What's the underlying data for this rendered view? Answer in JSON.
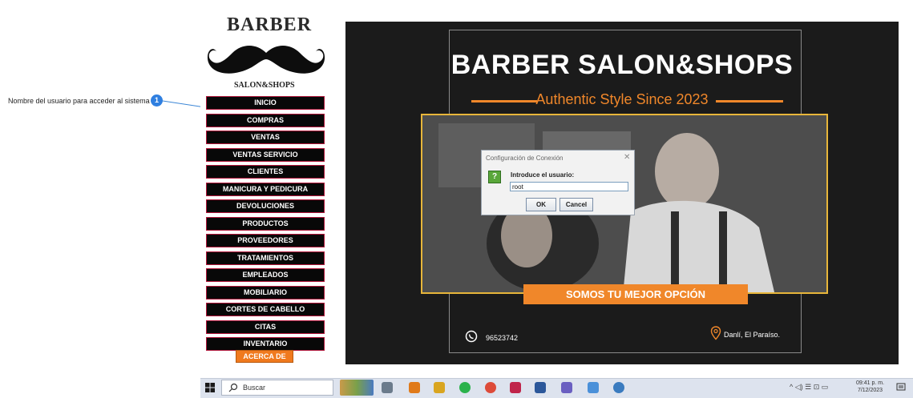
{
  "annotation": {
    "text": "Nombre del usuario para acceder al sistema",
    "badge": "1"
  },
  "app": {
    "logo_title": "BARBER",
    "logo_subtitle": "SALON&SHOPS",
    "menu": [
      "INICIO",
      "COMPRAS",
      "VENTAS",
      "VENTAS SERVICIO",
      "CLIENTES",
      "MANICURA Y PEDICURA",
      "DEVOLUCIONES",
      "PRODUCTOS",
      "PROVEEDORES",
      "TRATAMIENTOS",
      "EMPLEADOS",
      "MOBILIARIO",
      "CORTES DE CABELLO",
      "CITAS",
      "INVENTARIO"
    ],
    "about_label": "ACERCA DE"
  },
  "poster": {
    "title": "BARBER SALON&SHOPS",
    "tagline": "Authentic Style Since 2023",
    "ribbon": "SOMOS TU MEJOR OPCIÓN",
    "phone": "96523742",
    "location": "Danlí, El Paraíso."
  },
  "dialog": {
    "title": "Configuración de Conexión",
    "prompt": "Introduce el usuario:",
    "input_value": "root",
    "ok_label": "OK",
    "cancel_label": "Cancel"
  },
  "taskbar": {
    "search_placeholder": "Buscar",
    "time": "09:41 p. m.",
    "date": "7/12/2023"
  },
  "colors": {
    "menu_bg": "#080808",
    "menu_border": "#b0163a",
    "accent_orange": "#f0872a",
    "photo_border": "#e8b63a",
    "badge_blue": "#2f7fe0"
  }
}
